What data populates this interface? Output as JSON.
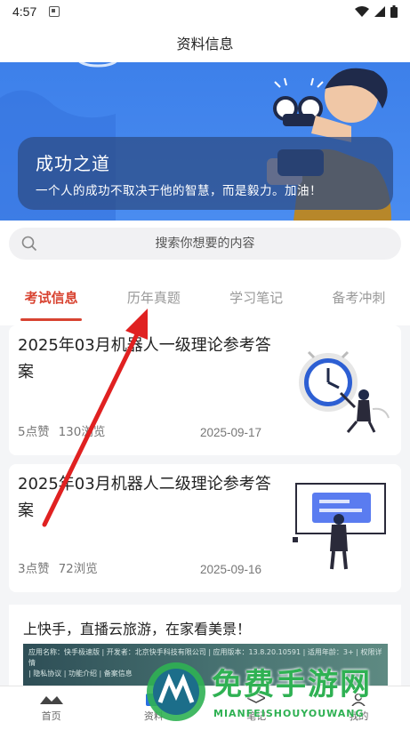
{
  "status_bar": {
    "time": "4:57"
  },
  "header": {
    "title": "资料信息"
  },
  "banner": {
    "title": "成功之道",
    "motto": "一个人的成功不取决于他的智慧，而是毅力。加油！"
  },
  "search": {
    "placeholder": "搜索你想要的内容"
  },
  "tabs": [
    {
      "label": "考试信息"
    },
    {
      "label": "历年真题"
    },
    {
      "label": "学习笔记"
    },
    {
      "label": "备考冲刺"
    }
  ],
  "articles": [
    {
      "title": "2025年03月机器人一级理论参考答案",
      "likes": "5点赞",
      "views": "130浏览",
      "date": "2025-09-17"
    },
    {
      "title": "2025年03月机器人二级理论参考答案",
      "likes": "3点赞",
      "views": "72浏览",
      "date": "2025-09-16"
    }
  ],
  "ad": {
    "title": "上快手，直播云旅游，在家看美景！",
    "info_line1": "应用名称：快手极速版 | 开发者：北京快手科技有限公司 | 应用版本：13.8.20.10591 | 适用年龄：3+ | 权限详情",
    "info_line2": "| 隐私协议 | 功能介绍 | 备案信息"
  },
  "bottom_nav": [
    {
      "label": "首页"
    },
    {
      "label": "资料"
    },
    {
      "label": "笔记"
    },
    {
      "label": "我的"
    }
  ],
  "watermark": {
    "main": "免费手游网",
    "sub": "MIANFEISHOUYOUWANG"
  },
  "colors": {
    "accent": "#d84331",
    "banner": "#3d80ea",
    "watermark": "#2fb153"
  }
}
